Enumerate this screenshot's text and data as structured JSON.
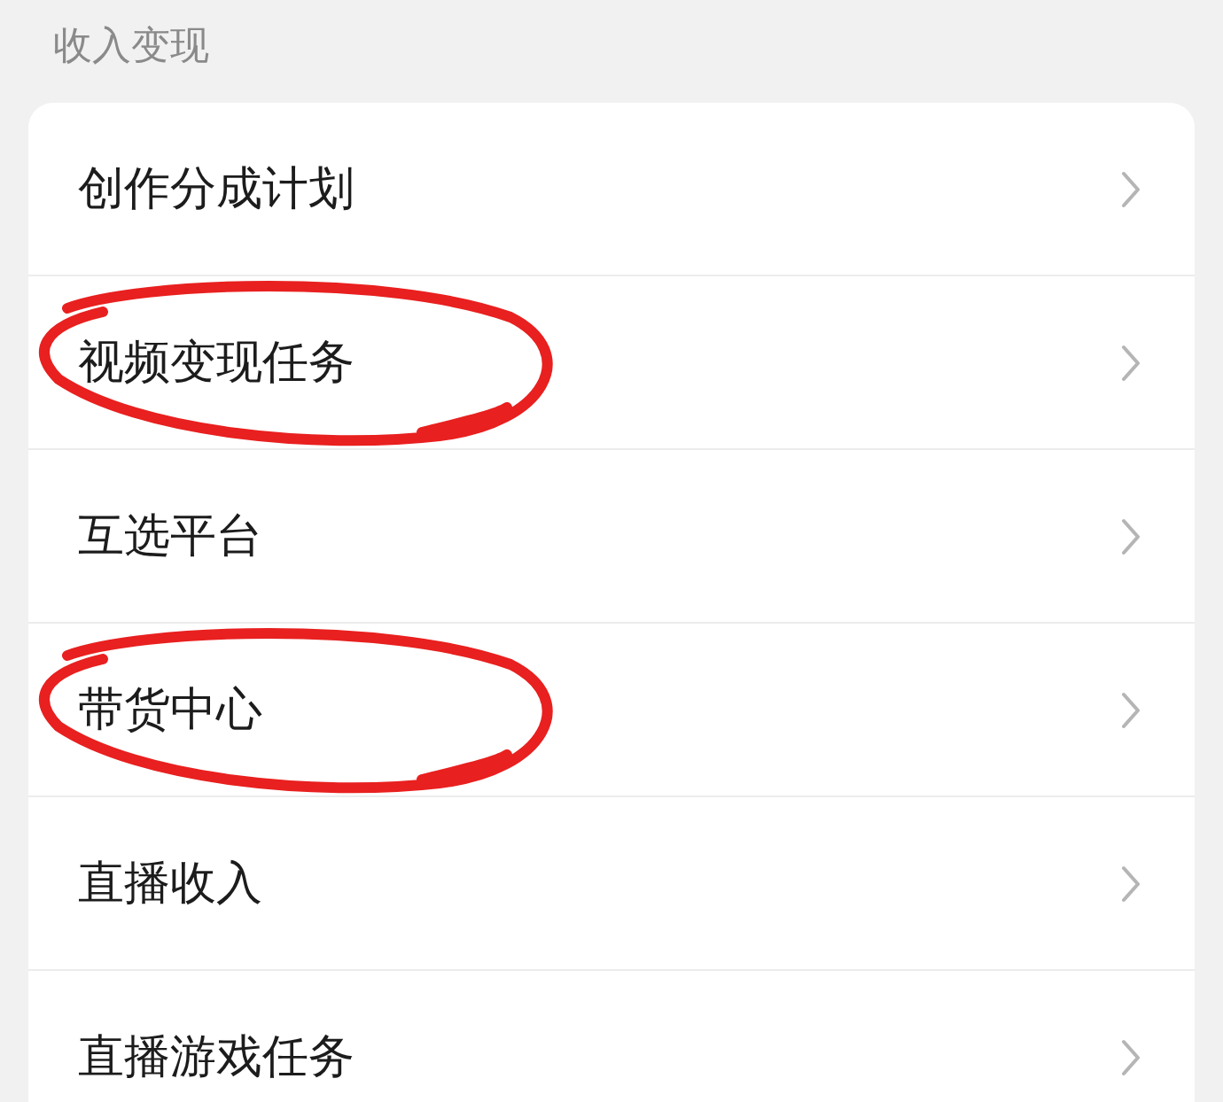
{
  "section_title": "收入变现",
  "items": [
    {
      "label": "创作分成计划",
      "circled": false
    },
    {
      "label": "视频变现任务",
      "circled": true
    },
    {
      "label": "互选平台",
      "circled": false
    },
    {
      "label": "带货中心",
      "circled": true
    },
    {
      "label": "直播收入",
      "circled": false
    },
    {
      "label": "直播游戏任务",
      "circled": false
    }
  ]
}
